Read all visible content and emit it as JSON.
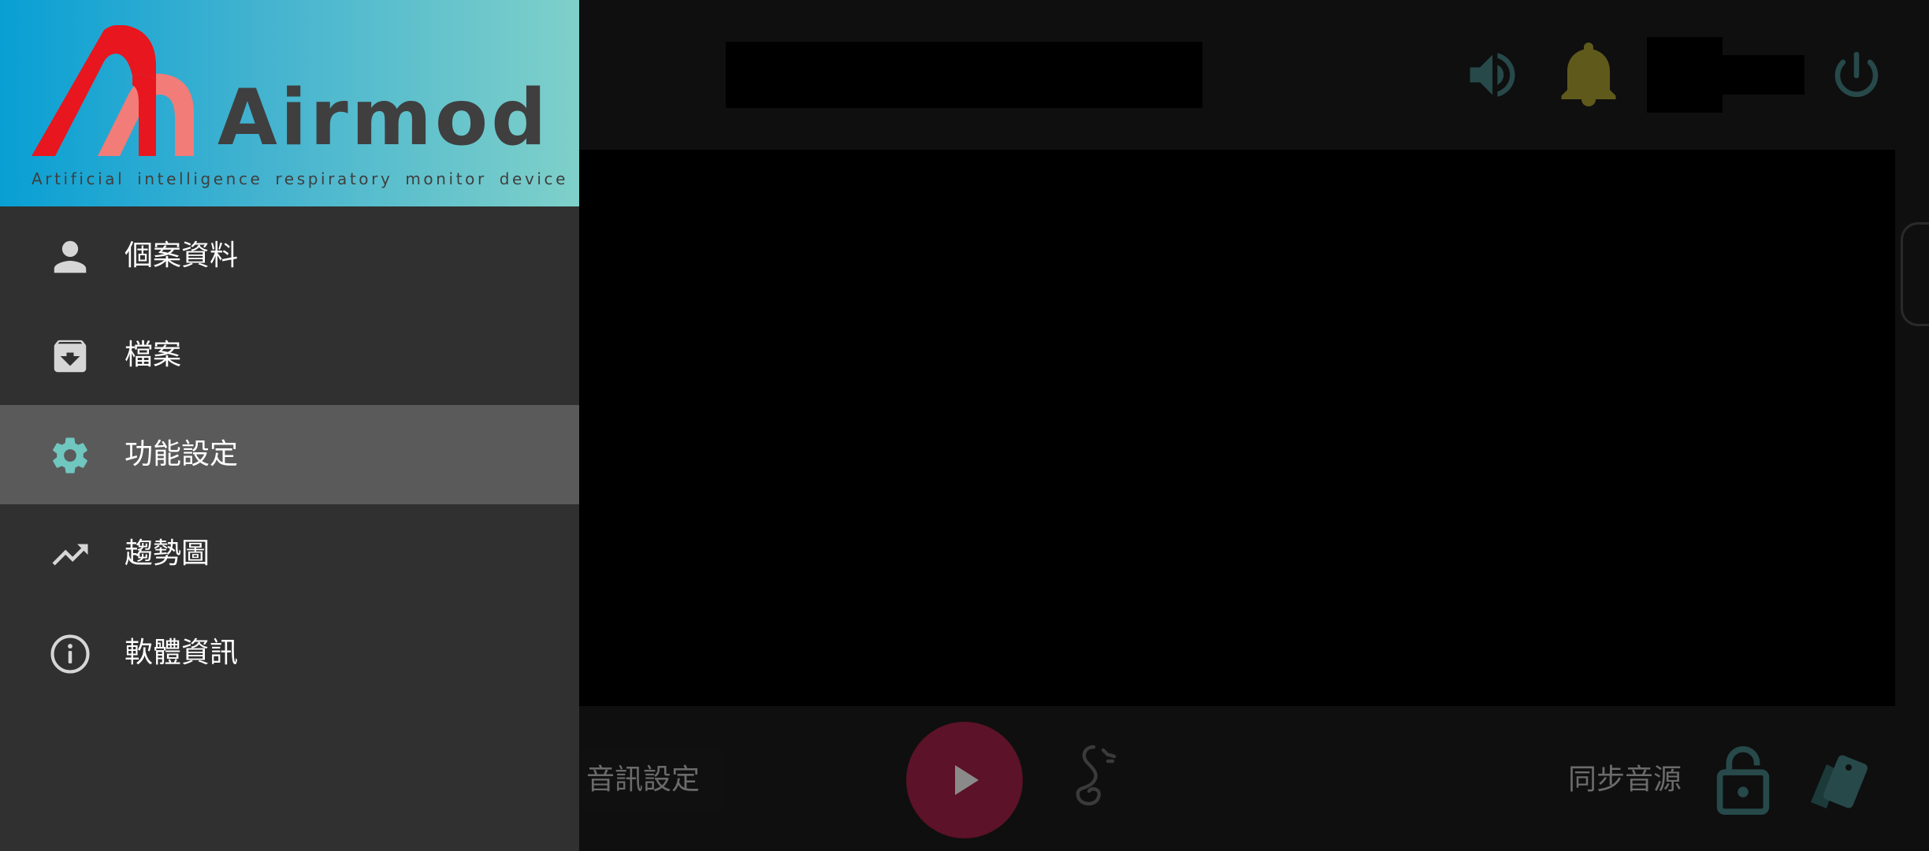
{
  "app": {
    "brand": "Airmod",
    "tagline": "Artificial intelligence respiratory monitor device",
    "logo_colors": {
      "mark_red": "#e8161e",
      "mark_pink": "#f27c78",
      "wordmark": "#3f3f3f",
      "header_gradient_start": "#089fd4",
      "header_gradient_end": "#7fd0c9"
    }
  },
  "drawer": {
    "items": [
      {
        "label": "個案資料",
        "icon": "person-icon",
        "active": false
      },
      {
        "label": "檔案",
        "icon": "archive-icon",
        "active": false
      },
      {
        "label": "功能設定",
        "icon": "gear-icon",
        "active": true
      },
      {
        "label": "趨勢圖",
        "icon": "trending-up-icon",
        "active": false
      },
      {
        "label": "軟體資訊",
        "icon": "info-icon",
        "active": false
      }
    ],
    "active_icon_color": "#6fc7c0",
    "icon_color": "#d6d6d6"
  },
  "topbar": {
    "icons": [
      "volume-icon",
      "bell-icon",
      "power-icon"
    ]
  },
  "bottombar": {
    "audio_settings_label": "音訊設定",
    "sync_audio_label": "同步音源",
    "icons": [
      "play-icon",
      "snail-icon",
      "lock-open-icon",
      "cards-icon"
    ]
  }
}
